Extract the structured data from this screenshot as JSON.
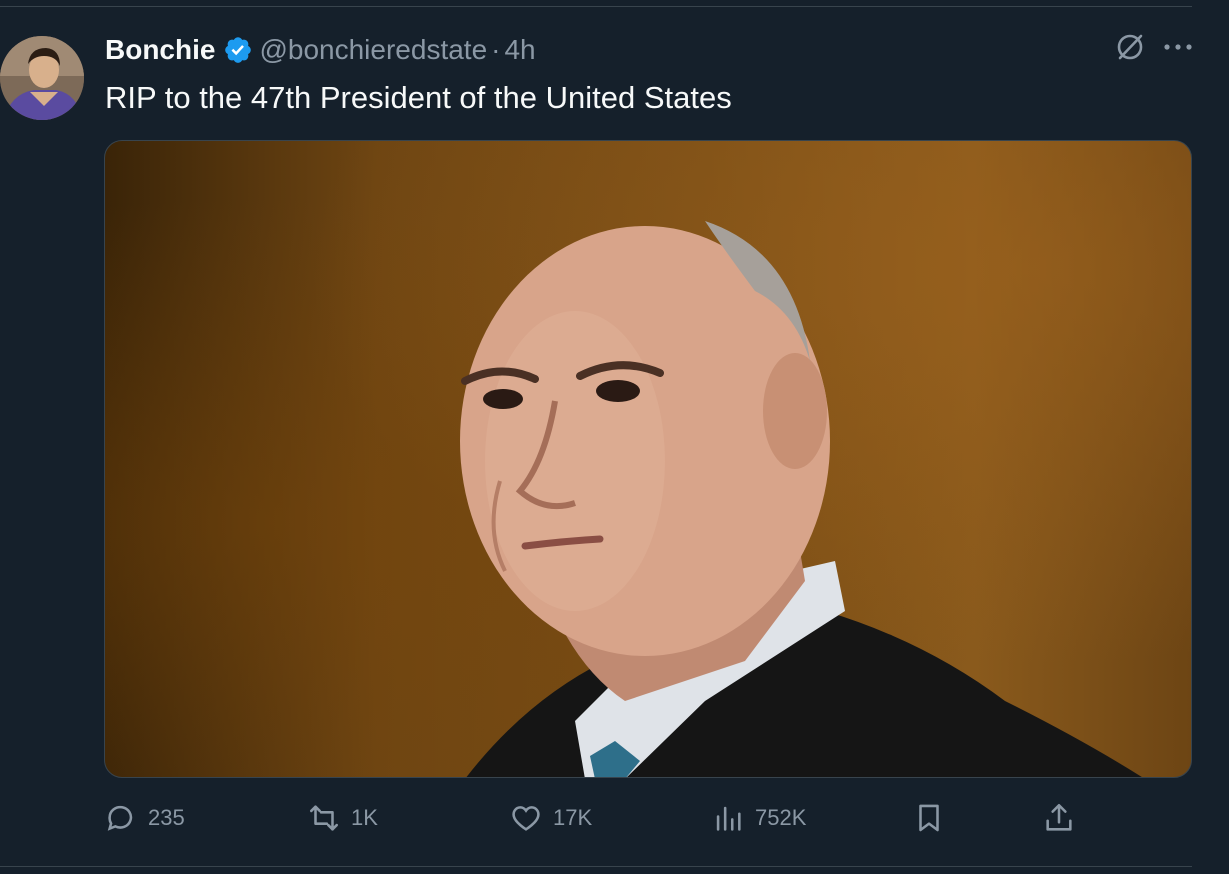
{
  "tweet": {
    "author": {
      "display_name": "Bonchie",
      "handle": "@bonchieredstate",
      "separator": "·",
      "timestamp": "4h",
      "verified": true
    },
    "text": "RIP to the 47th President of the United States",
    "media": {
      "kind": "photo"
    },
    "stats": {
      "replies": "235",
      "reposts": "1K",
      "likes": "17K",
      "views": "752K"
    }
  },
  "icons": {
    "header": [
      "grok-icon",
      "more-icon"
    ],
    "actions": [
      "reply-icon",
      "repost-icon",
      "like-icon",
      "views-icon",
      "bookmark-icon",
      "share-icon"
    ]
  },
  "colors": {
    "background": "#15202b",
    "text_primary": "#f7f9f9",
    "text_secondary": "#8b98a5",
    "verified_blue": "#1d9bf0",
    "divider": "#38444d"
  }
}
